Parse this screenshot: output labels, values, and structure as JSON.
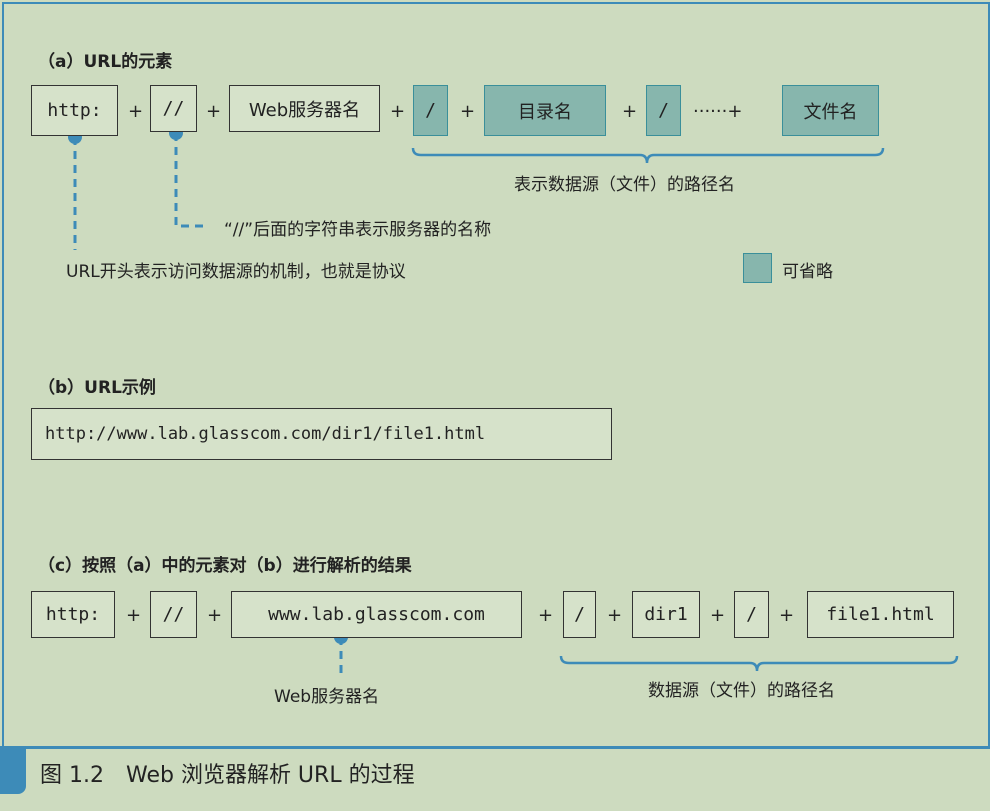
{
  "section_a": {
    "title": "（a）URL的元素",
    "boxes": {
      "http": "http:",
      "slashes": "//",
      "server": "Web服务器名",
      "slash1": "/",
      "dir": "目录名",
      "slash2": "/",
      "file": "文件名"
    },
    "ops": {
      "p1": "+",
      "p2": "+",
      "p3": "+",
      "p4": "+",
      "p5": "+",
      "dots": "······+"
    },
    "brace_label": "表示数据源（文件）的路径名",
    "note_slashes": "“//”后面的字符串表示服务器的名称",
    "note_url": "URL开头表示访问数据源的机制，也就是协议",
    "legend": "可省略"
  },
  "section_b": {
    "title": "（b）URL示例",
    "url": "http://www.lab.glasscom.com/dir1/file1.html"
  },
  "section_c": {
    "title": "（c）按照（a）中的元素对（b）进行解析的结果",
    "boxes": {
      "http": "http:",
      "slashes": "//",
      "server": "www.lab.glasscom.com",
      "slash1": "/",
      "dir": "dir1",
      "slash2": "/",
      "file": "file1.html"
    },
    "ops": {
      "p1": "+",
      "p2": "+",
      "p3": "+",
      "p4": "+",
      "p5": "+",
      "p6": "+"
    },
    "server_label": "Web服务器名",
    "brace_label": "数据源（文件）的路径名"
  },
  "caption": "图 1.2　Web 浏览器解析 URL 的过程",
  "colors": {
    "background": "#cddbbf",
    "accent": "#3d8bb8",
    "optional_fill": "#87b6ad"
  }
}
